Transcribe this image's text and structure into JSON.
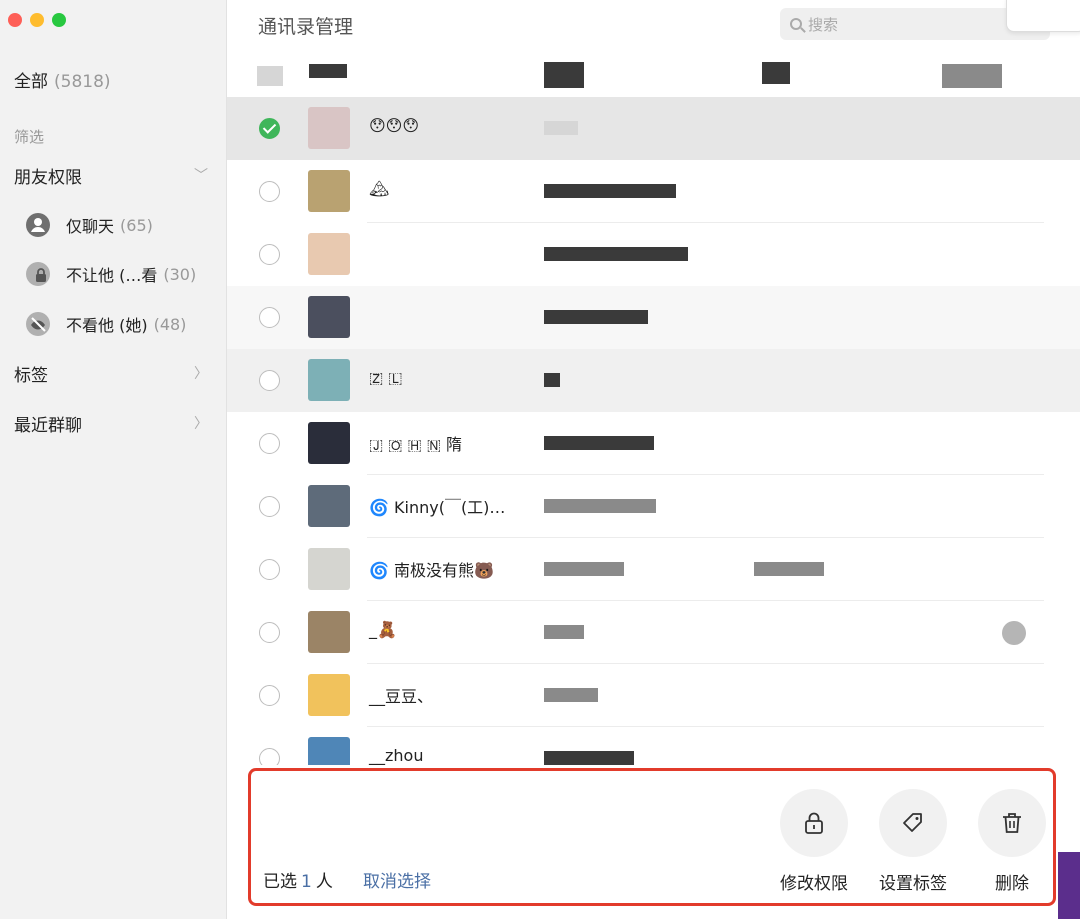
{
  "window": {
    "title": "通讯录管理"
  },
  "search": {
    "placeholder": "搜索"
  },
  "sidebar": {
    "all": {
      "label": "全部",
      "count": "(5818)"
    },
    "filter_label": "筛选",
    "friend_perms": {
      "label": "朋友权限",
      "items": [
        {
          "label": "仅聊天",
          "count": "(65)",
          "icon": "chat-only-icon"
        },
        {
          "label": "不让他 (…看",
          "count": "(30)",
          "icon": "lock-moments-icon"
        },
        {
          "label": "不看他 (她)",
          "count": "(48)",
          "icon": "eye-hidden-icon"
        }
      ]
    },
    "tags": {
      "label": "标签"
    },
    "recent_groups": {
      "label": "最近群聊"
    }
  },
  "contacts": [
    {
      "name": "😯😯😯",
      "checked": true,
      "avatar_color": "#d9c5c5"
    },
    {
      "name": "🏔",
      "checked": false,
      "avatar_color": "#b9a271"
    },
    {
      "name": "",
      "checked": false,
      "avatar_color": "#e8c9b0"
    },
    {
      "name": "",
      "checked": false,
      "avatar_color": "#4b4f5e"
    },
    {
      "name": "🇿 🇱",
      "checked": false,
      "avatar_color": "#7db0b6"
    },
    {
      "name": "🇯 🇴 🇭 🇳 隋",
      "checked": false,
      "avatar_color": "#2a2d3a"
    },
    {
      "name": "🌀 Kinny(￣(工)…",
      "checked": false,
      "avatar_color": "#5e6b7a"
    },
    {
      "name": "🌀 南极没有熊🐻",
      "checked": false,
      "avatar_color": "#d5d5d0"
    },
    {
      "name": "_🧸",
      "checked": false,
      "avatar_color": "#9b8466"
    },
    {
      "name": "__豆豆、",
      "checked": false,
      "avatar_color": "#f1c25c"
    },
    {
      "name": "__zhou",
      "checked": false,
      "avatar_color": "#4f86b7"
    }
  ],
  "bottom": {
    "selected_prefix": "已选",
    "selected_num": "1",
    "selected_suffix": "人",
    "cancel_label": "取消选择",
    "actions": [
      {
        "label": "修改权限",
        "icon": "lock-icon"
      },
      {
        "label": "设置标签",
        "icon": "tag-icon"
      },
      {
        "label": "删除",
        "icon": "trash-icon"
      }
    ]
  },
  "colors": {
    "accent_green": "#3fb65a",
    "link_blue": "#4a6fa5",
    "highlight_red": "#e23b2b"
  }
}
